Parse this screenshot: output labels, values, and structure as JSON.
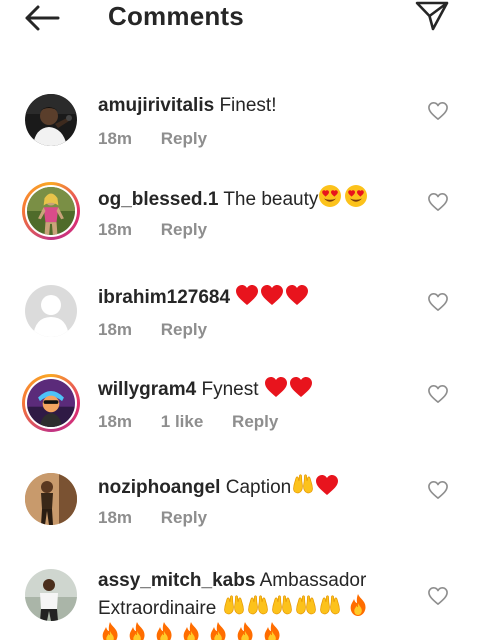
{
  "header": {
    "title": "Comments"
  },
  "comments": [
    {
      "username": "amujirivitalis",
      "text": "Finest!",
      "time": "18m",
      "reply": "Reply"
    },
    {
      "username": "og_blessed.1",
      "text": "The beauty",
      "time": "18m",
      "reply": "Reply"
    },
    {
      "username": "ibrahim127684",
      "text": "",
      "time": "18m",
      "reply": "Reply"
    },
    {
      "username": "willygram4",
      "text": "Fynest",
      "time": "18m",
      "likes": "1 like",
      "reply": "Reply"
    },
    {
      "username": "noziphoangel",
      "text": "Caption",
      "time": "18m",
      "reply": "Reply"
    },
    {
      "username": "assy_mitch_kabs",
      "text": "Ambassador Extraordinaire",
      "time": "",
      "reply": ""
    }
  ],
  "icons": {
    "back": "arrow-left-icon",
    "send": "paper-plane-icon",
    "heart": "heart-outline-icon"
  },
  "colors": {
    "text": "#262626",
    "muted": "#8e8e8e",
    "heart_red": "#ed1c24"
  }
}
